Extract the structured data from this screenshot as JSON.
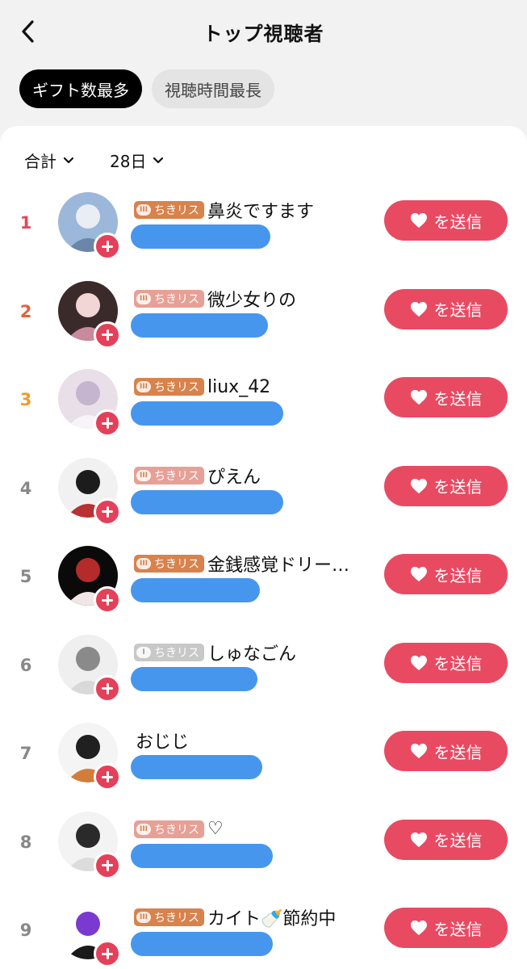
{
  "header": {
    "title": "トップ視聴者"
  },
  "tabs": [
    {
      "label": "ギフト数最多",
      "active": true
    },
    {
      "label": "視聴時間最長",
      "active": false
    }
  ],
  "filters": {
    "scope": "合計",
    "period": "28日"
  },
  "send_label": "を送信",
  "colors": {
    "accent": "#e84a62",
    "bar": "#4796ee",
    "rank1": "#e4475c",
    "rank2": "#e5613e",
    "rank3": "#f19a2d"
  },
  "viewers": [
    {
      "rank": "1",
      "badge": "ちきリス",
      "badge_style": "orange",
      "name": "鼻炎ですます",
      "bar_fraction": 0.265
    },
    {
      "rank": "2",
      "badge": "ちきリス",
      "badge_style": "pink",
      "name": "微少女りの",
      "bar_fraction": 0.26
    },
    {
      "rank": "3",
      "badge": "ちきリス",
      "badge_style": "orange",
      "name": "liux_42",
      "bar_fraction": 0.29
    },
    {
      "rank": "4",
      "badge": "ちきリス",
      "badge_style": "pink",
      "name": "ぴえん",
      "bar_fraction": 0.29
    },
    {
      "rank": "5",
      "badge": "ちきリス",
      "badge_style": "orange",
      "name": "金銭感覚ドリー…",
      "bar_fraction": 0.245
    },
    {
      "rank": "6",
      "badge": "ちきリス",
      "badge_style": "gray",
      "name": "しゅなごん",
      "bar_fraction": 0.24
    },
    {
      "rank": "7",
      "badge": "",
      "badge_style": "none",
      "name": "おじじ",
      "bar_fraction": 0.25
    },
    {
      "rank": "8",
      "badge": "ちきリス",
      "badge_style": "pink",
      "name": "♡",
      "bar_fraction": 0.27
    },
    {
      "rank": "9",
      "badge": "ちきリス",
      "badge_style": "orange",
      "name": "カイト🍼節約中",
      "bar_fraction": 0.27
    }
  ]
}
